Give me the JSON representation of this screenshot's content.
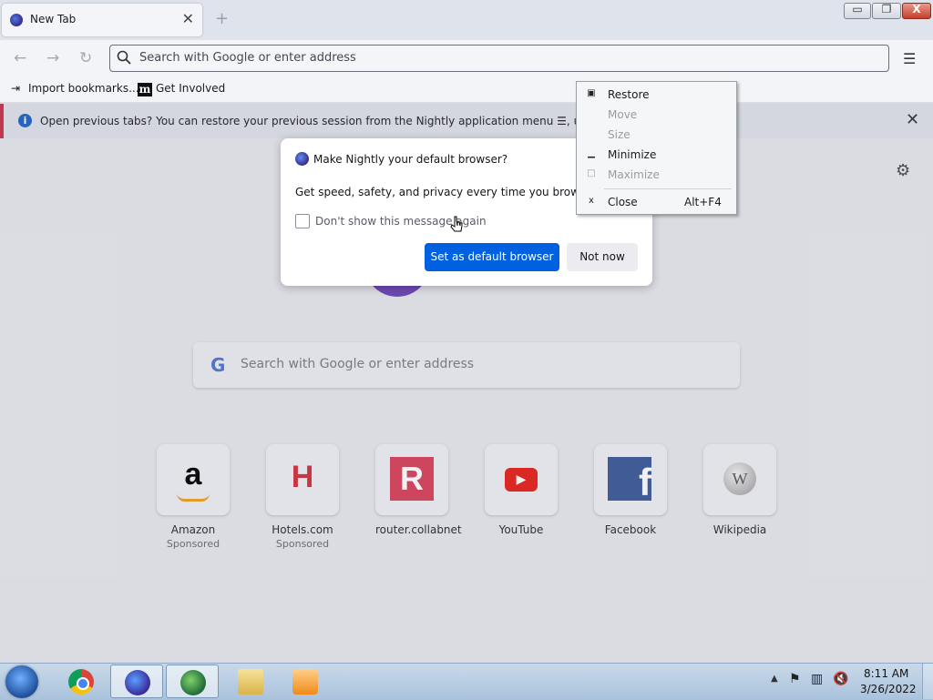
{
  "tab": {
    "title": "New Tab",
    "close": "✕",
    "new_tab": "+"
  },
  "window": {
    "minimize": "▭",
    "maximize": "❐",
    "close": "X"
  },
  "toolbar": {
    "back": "←",
    "forward": "→",
    "reload": "↻",
    "menu": "☰",
    "urlbar_placeholder": "Search with Google or enter address"
  },
  "bookmarks": {
    "import_icon": "⇥",
    "import_label": "Import bookmarks...",
    "get_involved_icon": "m",
    "get_involved_label": "Get Involved"
  },
  "notice": {
    "info": "i",
    "message": "Open previous tabs? You can restore your previous session from the Nightly application menu ☰, under History.",
    "close": "✕"
  },
  "newtab": {
    "gear": "⚙",
    "google_g": "G",
    "search_placeholder": "Search with Google or enter address",
    "sites": [
      {
        "name": "Amazon",
        "sub": "Sponsored",
        "glyph": "a",
        "color": "#111111"
      },
      {
        "name": "Hotels.com",
        "sub": "Sponsored",
        "glyph": "H",
        "color": "#d32f3c"
      },
      {
        "name": "router.collabnet",
        "sub": "",
        "glyph": "R",
        "color": "#d9405a"
      },
      {
        "name": "YouTube",
        "sub": "",
        "glyph": "▶",
        "color": "#e62117"
      },
      {
        "name": "Facebook",
        "sub": "",
        "glyph": "f",
        "color": "#3b5998"
      },
      {
        "name": "Wikipedia",
        "sub": "",
        "glyph": "W",
        "color": "#888888"
      }
    ]
  },
  "dialog": {
    "title": "Make Nightly your default browser?",
    "body": "Get speed, safety, and privacy every time you browse.",
    "checkbox_label": "Don't show this message again",
    "primary": "Set as default browser",
    "secondary": "Not now"
  },
  "sysmenu": {
    "restore": {
      "icon": "▣",
      "label": "Restore"
    },
    "move": {
      "label": "Move"
    },
    "size": {
      "label": "Size"
    },
    "minimize": {
      "icon": "▁",
      "label": "Minimize"
    },
    "maximize": {
      "icon": "□",
      "label": "Maximize"
    },
    "close": {
      "icon": "x",
      "label": "Close",
      "shortcut": "Alt+F4"
    }
  },
  "taskbar": {
    "tray_arrow": "▲",
    "flag": "⚑",
    "network": "▥",
    "volume": "🔇",
    "time": "8:11 AM",
    "date": "3/26/2022"
  }
}
